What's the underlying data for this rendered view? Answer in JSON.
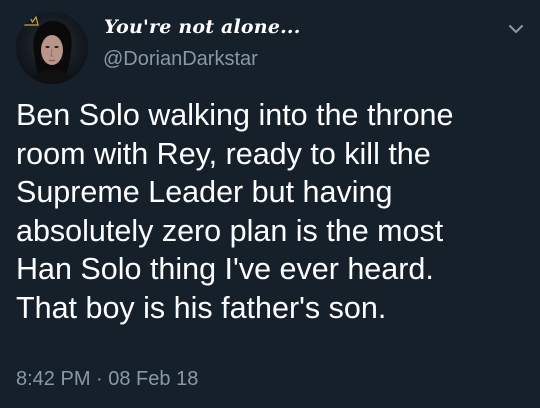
{
  "theme": {
    "background": "#15202b",
    "text_primary": "#ffffff",
    "text_secondary": "#8899a6"
  },
  "author": {
    "display_name": "You're not alone...",
    "handle": "@DorianDarkstar",
    "avatar_icon": "profile-avatar",
    "avatar_badge_icon": "crown-icon"
  },
  "tweet": {
    "text": "Ben Solo walking into the throne\nroom with Rey, ready to kill the\nSupreme Leader but having\nabsolutely zero plan is the most\nHan Solo thing I've ever heard.\nThat boy is his father's son.",
    "timestamp": "8:42 PM · 08 Feb 18"
  },
  "menu": {
    "icon": "chevron-down-icon"
  }
}
